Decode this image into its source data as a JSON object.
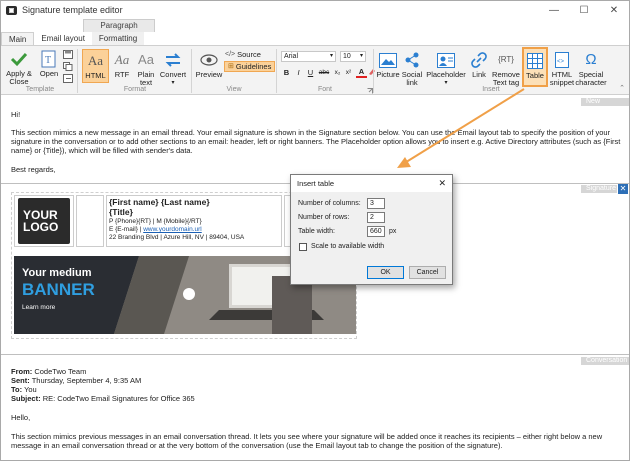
{
  "window": {
    "title": "Signature template editor",
    "minimize": "—",
    "maximize": "☐",
    "close": "✕"
  },
  "contextual_tab": "Paragraph",
  "tabs": [
    "Main",
    "Email layout",
    "Formatting"
  ],
  "ribbon": {
    "apply_close": "Apply & Close",
    "open": "Open",
    "template_group": "Template",
    "html": "HTML",
    "rtf": "RTF",
    "plain": "Plain text",
    "convert": "Convert",
    "format_group": "Format",
    "preview": "Preview",
    "source": "Source",
    "guidelines": "Guidelines",
    "view_group": "View",
    "font_name": "Arial",
    "font_size": "10",
    "font_group": "Font",
    "bold": "B",
    "italic": "I",
    "underline": "U",
    "strike": "abc",
    "subscript": "x₂",
    "superscript": "x²",
    "font_color": "A",
    "picture": "Picture",
    "social": "Social link",
    "placeholder": "Placeholder",
    "link": "Link",
    "remove": "Remove Text tag",
    "table": "Table",
    "html_snippet": "HTML snippet",
    "special": "Special character",
    "insert_group": "Insert"
  },
  "sections": {
    "new_message": "New message",
    "signature": "Signature",
    "conversation": "Conversation"
  },
  "message": {
    "greeting": "Hi!",
    "para": "This section mimics a new message in an email thread. Your email signature is shown in the Signature section below. You can use the Email layout tab to specify the position of your signature in the conversation or to add other sections to an email: header, left or right banners. The Placeholder option allows you to insert e.g. Active Directory attributes (such as {First name} or {Title}), which will be filled with sender's data.",
    "regards": "Best regards,"
  },
  "signature": {
    "logo_line1": "YOUR",
    "logo_line2": "LOGO",
    "name": "{First name} {Last name}",
    "title": "{Title}",
    "phone_line": "P {Phone}{RT} | M {Mobile}{/RT}",
    "email_prefix": "E {E-mail} | ",
    "url": "www.yourdomain.url",
    "address": "22 Branding Blvd | Azure Hill, NV | 89404, USA",
    "banner_line1": "Your medium",
    "banner_line2": "BANNER",
    "banner_cta": "Learn more"
  },
  "conversation": {
    "from_label": "From:",
    "from": "CodeTwo Team",
    "sent_label": "Sent:",
    "sent": "Thursday, September 4, 9:35 AM",
    "to_label": "To:",
    "to": "You",
    "subject_label": "Subject:",
    "subject": "RE: CodeTwo Email Signatures for Office 365",
    "hello": "Hello,",
    "para": "This section mimics previous messages in an email conversation thread. It lets you see where your signature will be added once it reaches its recipients – either right below a new message in an email conversation thread or at the very bottom of the conversation (use the Email layout tab to change the position of the signature)."
  },
  "dialog": {
    "title": "Insert table",
    "cols_label": "Number of columns:",
    "cols": "3",
    "rows_label": "Number of rows:",
    "rows": "2",
    "width_label": "Table width:",
    "width": "660",
    "width_unit": "px",
    "scale_label": "Scale to available width",
    "ok": "OK",
    "cancel": "Cancel"
  },
  "colors": {
    "accent": "#f0a048",
    "link": "#1a5fb4",
    "banner_blue": "#2f9ee0"
  }
}
